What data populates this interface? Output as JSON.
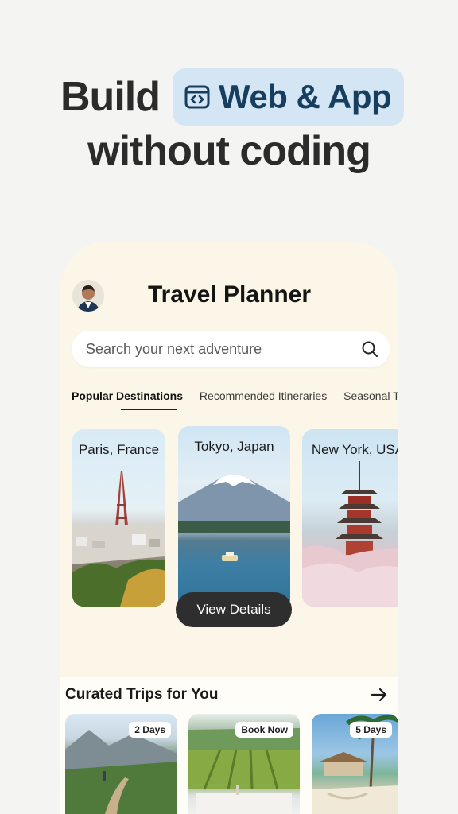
{
  "hero": {
    "line1_word": "Build",
    "chip_label": "Web & App",
    "line2": "without coding",
    "chip_icon": "code-window-icon",
    "chip_bg": "#d4e6f4",
    "chip_text_color": "#173e5e"
  },
  "app": {
    "title": "Travel Planner",
    "avatar_icon": "avatar-icon",
    "search": {
      "placeholder": "Search your next adventure",
      "icon": "search-icon"
    },
    "tabs": [
      {
        "label": "Popular Destinations",
        "active": true
      },
      {
        "label": "Recommended Itineraries",
        "active": false
      },
      {
        "label": "Seasonal Trips",
        "active": false
      }
    ],
    "destinations": [
      {
        "label": "Paris, France"
      },
      {
        "label": "Tokyo, Japan"
      },
      {
        "label": "New York, USA"
      }
    ],
    "view_details_label": "View Details",
    "curated": {
      "title": "Curated Trips for You",
      "arrow_icon": "arrow-right-icon",
      "trips": [
        {
          "badge": "2 Days"
        },
        {
          "badge": "Book Now"
        },
        {
          "badge": "5 Days"
        }
      ]
    },
    "background": "#fbf6e8"
  }
}
